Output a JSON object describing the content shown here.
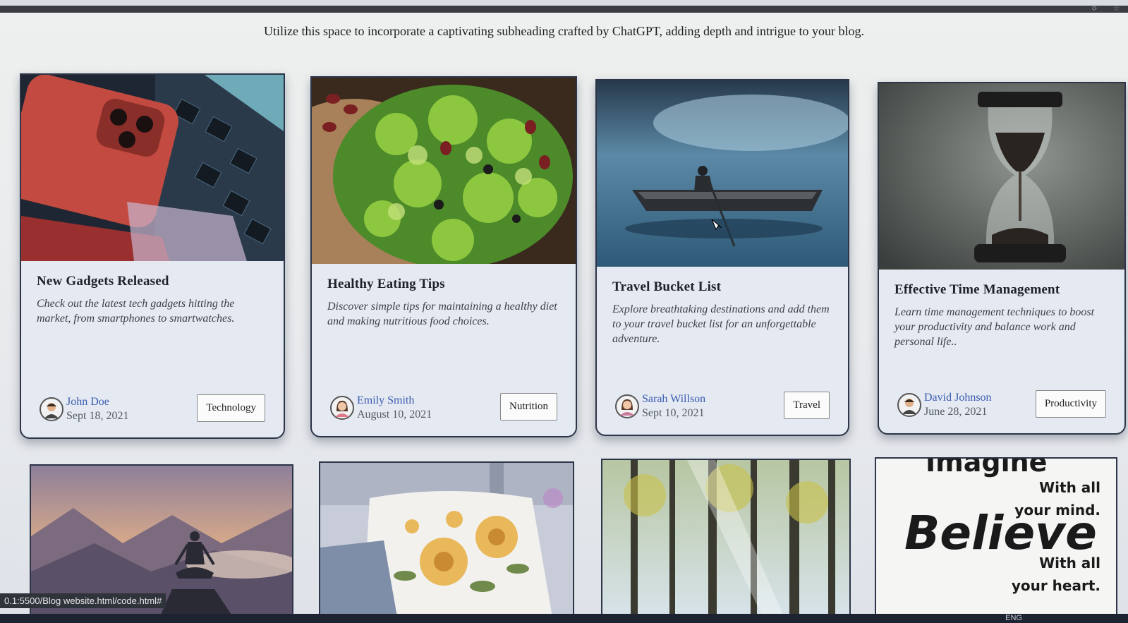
{
  "subheading": "Utilize this space to incorporate a captivating subheading crafted by ChatGPT, adding depth and intrigue to your blog.",
  "cards": [
    {
      "title": "New Gadgets Released",
      "description": "Check out the latest tech gadgets hitting the market, from smartphones to smartwatches.",
      "author": "John Doe",
      "date": "Sept 18, 2021",
      "tag": "Technology"
    },
    {
      "title": "Healthy Eating Tips",
      "description": "Discover simple tips for maintaining a healthy diet and making nutritious food choices.",
      "author": "Emily Smith",
      "date": "August 10, 2021",
      "tag": "Nutrition"
    },
    {
      "title": "Travel Bucket List",
      "description": "Explore breathtaking destinations and add them to your travel bucket list for an unforgettable adventure.",
      "author": "Sarah Willson",
      "date": "Sept 10, 2021",
      "tag": "Travel"
    },
    {
      "title": "Effective Time Management",
      "description": "Learn time management techniques to boost your productivity and balance work and personal life..",
      "author": "David Johnson",
      "date": "June 28, 2021",
      "tag": "Productivity"
    }
  ],
  "quote_image_text": {
    "line1": "Imagine",
    "line2": "With all",
    "line3": "your mind.",
    "line4": "Believe",
    "line5": "With all",
    "line6": "your heart."
  },
  "status_url": "0.1:5500/Blog website.html/code.html#",
  "taskbar_lang": "ENG"
}
